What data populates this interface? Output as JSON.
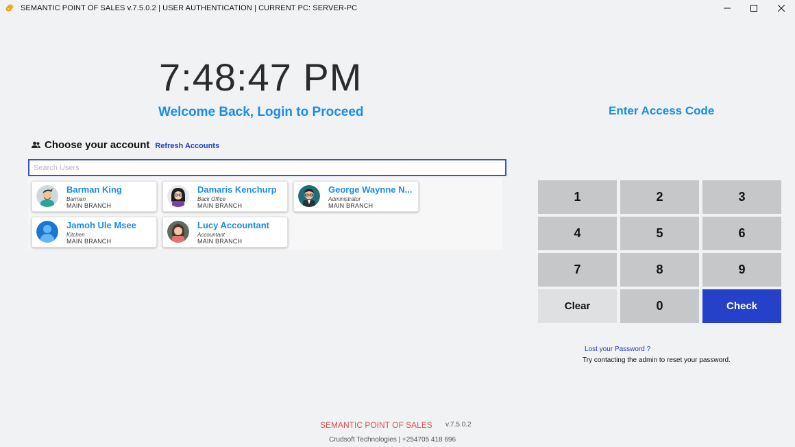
{
  "window": {
    "title": "SEMANTIC POINT OF SALES v.7.5.0.2 | USER AUTHENTICATION | CURRENT PC: SERVER-PC",
    "icon": "pos-app-icon"
  },
  "clock": "7:48:47 PM",
  "welcome": "Welcome Back, Login to Proceed",
  "access_code_title": "Enter Access Code",
  "accounts": {
    "title": "Choose your account",
    "refresh_label": "Refresh Accounts",
    "search_placeholder": "Search Users",
    "users": [
      {
        "name": "Barman King",
        "role": "Barman",
        "branch": "MAIN BRANCH"
      },
      {
        "name": "Damaris Kenchurp",
        "role": "Back Office",
        "branch": "MAIN BRANCH"
      },
      {
        "name": "George Waynne N...",
        "role": "Administrator",
        "branch": "MAIN BRANCH"
      },
      {
        "name": "Jamoh Ule Msee",
        "role": "Kitchen",
        "branch": "MAIN BRANCH"
      },
      {
        "name": "Lucy Accountant",
        "role": "Accountant",
        "branch": "MAIN BRANCH"
      }
    ]
  },
  "keypad": {
    "keys": [
      "1",
      "2",
      "3",
      "4",
      "5",
      "6",
      "7",
      "8",
      "9"
    ],
    "clear": "Clear",
    "zero": "0",
    "check": "Check"
  },
  "password_help": {
    "link": "Lost your Password ?",
    "text": "Try contacting the admin to reset your password."
  },
  "footer": {
    "title": "SEMANTIC POINT OF SALES",
    "version": "v.7.5.0.2",
    "subtitle": "Crudsoft Technologies | +254705 418 696"
  },
  "colors": {
    "accent": "#1a8ce8",
    "check_button": "#2641c9",
    "footer_title": "#d9534f"
  }
}
